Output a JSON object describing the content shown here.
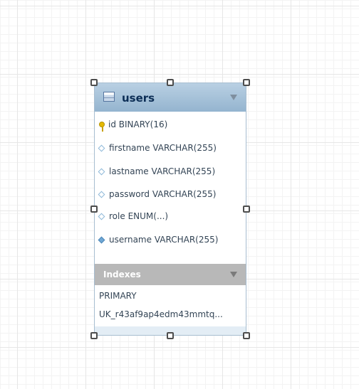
{
  "table": {
    "name": "users",
    "columns": [
      {
        "name": "id",
        "type": "BINARY(16)",
        "icon": "primary-key-icon"
      },
      {
        "name": "firstname",
        "type": "VARCHAR(255)",
        "icon": "column-diamond-icon"
      },
      {
        "name": "lastname",
        "type": "VARCHAR(255)",
        "icon": "column-diamond-icon"
      },
      {
        "name": "password",
        "type": "VARCHAR(255)",
        "icon": "column-diamond-icon"
      },
      {
        "name": "role",
        "type": "ENUM(...)",
        "icon": "column-diamond-icon"
      },
      {
        "name": "username",
        "type": "VARCHAR(255)",
        "icon": "unique-column-diamond-icon"
      }
    ]
  },
  "indexes": {
    "label": "Indexes",
    "items": [
      "PRIMARY",
      "UK_r43af9ap4edm43mmtq..."
    ]
  },
  "colors": {
    "header_top": "#b9d0e3",
    "header_bottom": "#94b4cf",
    "indexes_header": "#b8b8b8",
    "grid_line": "#e6e6e6"
  }
}
